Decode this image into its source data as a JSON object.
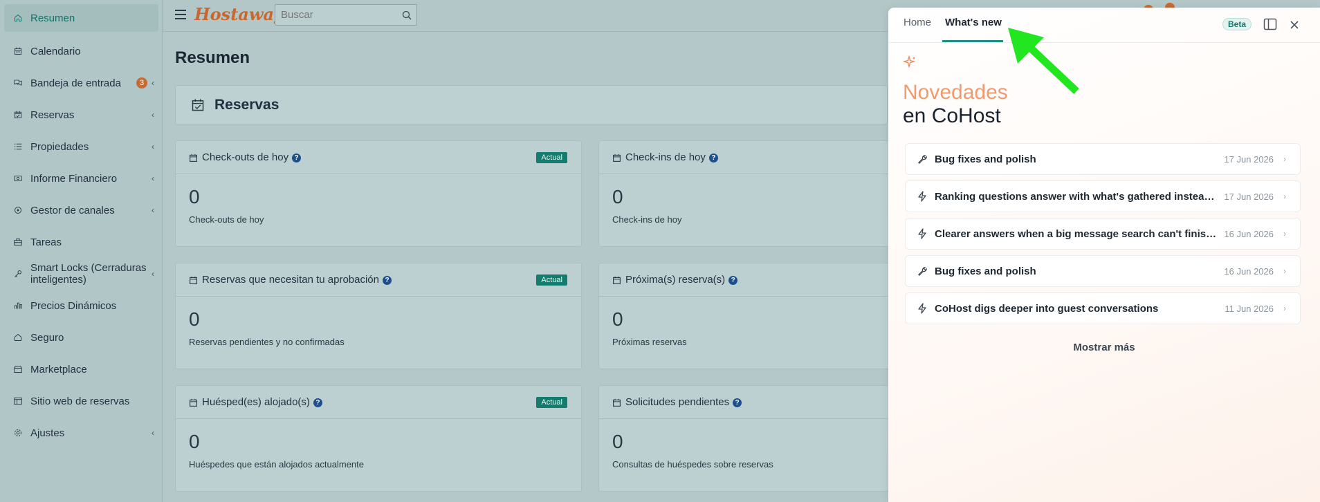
{
  "sidebar": {
    "items": [
      {
        "label": "Resumen",
        "icon": "home-icon"
      },
      {
        "label": "Calendario",
        "icon": "calendar-icon"
      },
      {
        "label": "Bandeja de entrada",
        "icon": "chat-icon",
        "badge": "3"
      },
      {
        "label": "Reservas",
        "icon": "calendar-check-icon"
      },
      {
        "label": "Propiedades",
        "icon": "list-icon"
      },
      {
        "label": "Informe Financiero",
        "icon": "money-icon"
      },
      {
        "label": "Gestor de canales",
        "icon": "channels-icon"
      },
      {
        "label": "Tareas",
        "icon": "briefcase-icon"
      },
      {
        "label": "Smart Locks (Cerraduras inteligentes)",
        "icon": "key-icon"
      },
      {
        "label": "Precios Dinámicos",
        "icon": "bar-chart-icon"
      },
      {
        "label": "Seguro",
        "icon": "home-shield-icon"
      },
      {
        "label": "Marketplace",
        "icon": "store-icon"
      },
      {
        "label": "Sitio web de reservas",
        "icon": "website-icon"
      },
      {
        "label": "Ajustes",
        "icon": "gear-icon"
      }
    ]
  },
  "topbar": {
    "logo": "Hostaway",
    "search_placeholder": "Buscar"
  },
  "main": {
    "title": "Resumen",
    "section_title": "Reservas",
    "cards": [
      {
        "title": "Check-outs de hoy",
        "tag": "Actual",
        "value": "0",
        "subtitle": "Check-outs de hoy"
      },
      {
        "title": "Check-ins de hoy",
        "tag": "",
        "value": "0",
        "subtitle": "Check-ins de hoy"
      },
      {
        "title": "Reservas que necesitan tu aprobación",
        "tag": "Actual",
        "value": "0",
        "subtitle": "Reservas pendientes y no confirmadas"
      },
      {
        "title": "Próxima(s) reserva(s)",
        "tag": "",
        "value": "0",
        "subtitle": "Próximas reservas"
      },
      {
        "title": "Huésped(es) alojado(s)",
        "tag": "Actual",
        "value": "0",
        "subtitle": "Huéspedes que están alojados actualmente"
      },
      {
        "title": "Solicitudes pendientes",
        "tag": "",
        "value": "0",
        "subtitle": "Consultas de huéspedes sobre reservas"
      }
    ]
  },
  "panel": {
    "tabs": [
      "Home",
      "What's new"
    ],
    "active_tab": "What's new",
    "beta": "Beta",
    "heading_line1": "Novedades",
    "heading_line2": "en CoHost",
    "items": [
      {
        "title": "Bug fixes and polish",
        "date": "17 Jun 2026",
        "icon": "wrench-icon"
      },
      {
        "title": "Ranking questions answer with what's gathered instead ...",
        "date": "17 Jun 2026",
        "icon": "lightning-icon"
      },
      {
        "title": "Clearer answers when a big message search can't finish ...",
        "date": "16 Jun 2026",
        "icon": "lightning-icon"
      },
      {
        "title": "Bug fixes and polish",
        "date": "16 Jun 2026",
        "icon": "wrench-icon"
      },
      {
        "title": "CoHost digs deeper into guest conversations",
        "date": "11 Jun 2026",
        "icon": "lightning-icon"
      }
    ],
    "show_more": "Mostrar más"
  },
  "colors": {
    "accent": "#1a8f82",
    "brand": "#c9672f",
    "highlight_orange": "#f29a6f",
    "annotation_arrow": "#22e61f"
  }
}
